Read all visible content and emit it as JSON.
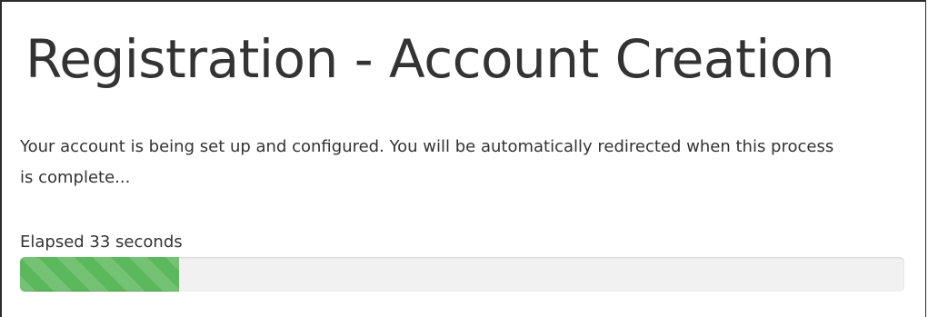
{
  "page": {
    "title": "Registration - Account Creation",
    "message": "Your account is being set up and configured. You will be automatically redirected when this process is complete...",
    "elapsed_text": "Elapsed 33 seconds"
  },
  "progress": {
    "fraction": 0.18,
    "color": "#5cb85c",
    "track_color": "#f1f1f1"
  }
}
